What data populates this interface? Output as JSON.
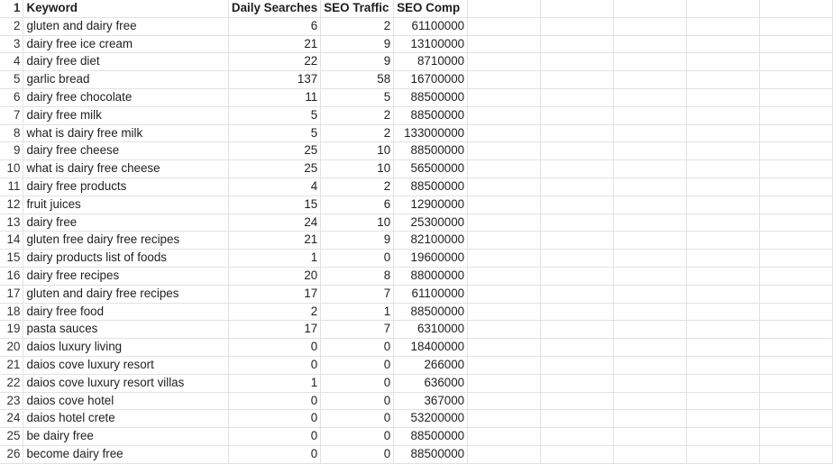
{
  "sheet": {
    "headers": {
      "row_number": "1",
      "keyword": "Keyword",
      "daily_searches": "Daily Searches",
      "seo_traffic": "SEO Traffic",
      "seo_comp": "SEO Comp"
    },
    "rows": [
      {
        "n": "2",
        "keyword": "gluten and dairy free",
        "daily": "6",
        "traffic": "2",
        "comp": "61100000"
      },
      {
        "n": "3",
        "keyword": "dairy free ice cream",
        "daily": "21",
        "traffic": "9",
        "comp": "13100000"
      },
      {
        "n": "4",
        "keyword": "dairy free diet",
        "daily": "22",
        "traffic": "9",
        "comp": "8710000"
      },
      {
        "n": "5",
        "keyword": "garlic bread",
        "daily": "137",
        "traffic": "58",
        "comp": "16700000"
      },
      {
        "n": "6",
        "keyword": "dairy free chocolate",
        "daily": "11",
        "traffic": "5",
        "comp": "88500000"
      },
      {
        "n": "7",
        "keyword": "dairy free milk",
        "daily": "5",
        "traffic": "2",
        "comp": "88500000"
      },
      {
        "n": "8",
        "keyword": "what is dairy free milk",
        "daily": "5",
        "traffic": "2",
        "comp": "133000000"
      },
      {
        "n": "9",
        "keyword": "dairy free cheese",
        "daily": "25",
        "traffic": "10",
        "comp": "88500000"
      },
      {
        "n": "10",
        "keyword": "what is dairy free cheese",
        "daily": "25",
        "traffic": "10",
        "comp": "56500000"
      },
      {
        "n": "11",
        "keyword": "dairy free products",
        "daily": "4",
        "traffic": "2",
        "comp": "88500000"
      },
      {
        "n": "12",
        "keyword": "fruit juices",
        "daily": "15",
        "traffic": "6",
        "comp": "12900000"
      },
      {
        "n": "13",
        "keyword": "dairy free",
        "daily": "24",
        "traffic": "10",
        "comp": "25300000"
      },
      {
        "n": "14",
        "keyword": "gluten free dairy free recipes",
        "daily": "21",
        "traffic": "9",
        "comp": "82100000"
      },
      {
        "n": "15",
        "keyword": "dairy products list of foods",
        "daily": "1",
        "traffic": "0",
        "comp": "19600000"
      },
      {
        "n": "16",
        "keyword": "dairy free recipes",
        "daily": "20",
        "traffic": "8",
        "comp": "88000000"
      },
      {
        "n": "17",
        "keyword": "gluten and dairy free recipes",
        "daily": "17",
        "traffic": "7",
        "comp": "61100000"
      },
      {
        "n": "18",
        "keyword": "dairy free food",
        "daily": "2",
        "traffic": "1",
        "comp": "88500000"
      },
      {
        "n": "19",
        "keyword": "pasta sauces",
        "daily": "17",
        "traffic": "7",
        "comp": "6310000"
      },
      {
        "n": "20",
        "keyword": "daios luxury living",
        "daily": "0",
        "traffic": "0",
        "comp": "18400000"
      },
      {
        "n": "21",
        "keyword": "daios cove luxury resort",
        "daily": "0",
        "traffic": "0",
        "comp": "266000"
      },
      {
        "n": "22",
        "keyword": "daios cove luxury resort villas",
        "daily": "1",
        "traffic": "0",
        "comp": "636000"
      },
      {
        "n": "23",
        "keyword": "daios cove hotel",
        "daily": "0",
        "traffic": "0",
        "comp": "367000"
      },
      {
        "n": "24",
        "keyword": "daios hotel crete",
        "daily": "0",
        "traffic": "0",
        "comp": "53200000"
      },
      {
        "n": "25",
        "keyword": "be dairy free",
        "daily": "0",
        "traffic": "0",
        "comp": "88500000"
      },
      {
        "n": "26",
        "keyword": "become dairy free",
        "daily": "0",
        "traffic": "0",
        "comp": "88500000"
      }
    ]
  }
}
